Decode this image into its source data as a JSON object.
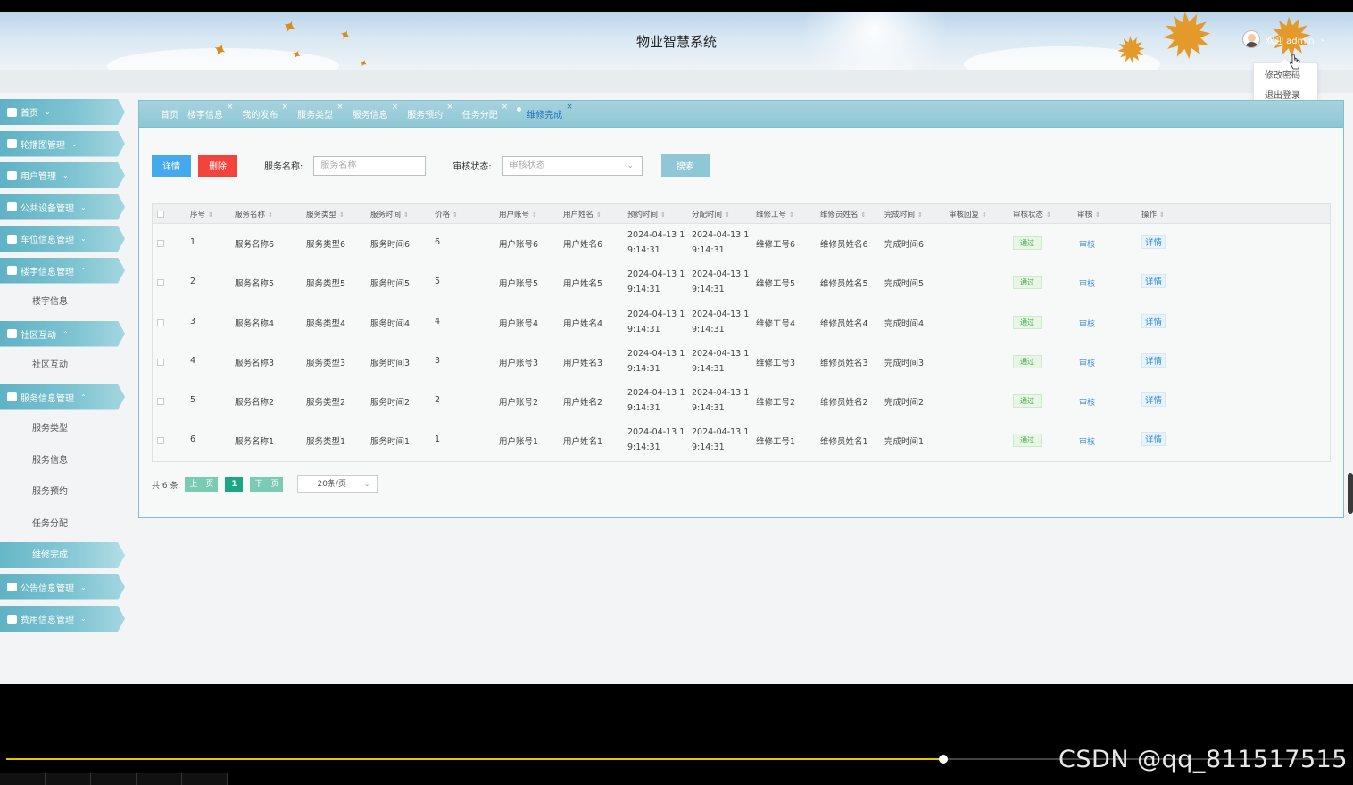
{
  "header": {
    "title": "物业智慧系统",
    "welcome": "欢迎 admin",
    "menu": [
      "修改密码",
      "退出登录"
    ]
  },
  "sidebar": {
    "items": [
      {
        "label": "首页",
        "icon": "home-icon",
        "type": "nav"
      },
      {
        "label": "轮播图管理",
        "icon": "image-icon",
        "type": "nav"
      },
      {
        "label": "用户管理",
        "icon": "user-icon",
        "type": "nav"
      },
      {
        "label": "公共设备管理",
        "icon": "grid-icon",
        "type": "nav"
      },
      {
        "label": "车位信息管理",
        "icon": "car-icon",
        "type": "nav"
      },
      {
        "label": "楼宇信息管理",
        "icon": "building-icon",
        "type": "nav-open"
      },
      {
        "label": "楼宇信息",
        "type": "sub"
      },
      {
        "label": "社区互动",
        "icon": "community-icon",
        "type": "nav-open"
      },
      {
        "label": "社区互动",
        "type": "sub"
      },
      {
        "label": "服务信息管理",
        "icon": "service-icon",
        "type": "nav-open"
      },
      {
        "label": "服务类型",
        "type": "sub"
      },
      {
        "label": "服务信息",
        "type": "sub"
      },
      {
        "label": "服务预约",
        "type": "sub"
      },
      {
        "label": "任务分配",
        "type": "sub"
      },
      {
        "label": "维修完成",
        "type": "sub-active"
      },
      {
        "label": "公告信息管理",
        "icon": "notice-icon",
        "type": "nav"
      },
      {
        "label": "费用信息管理",
        "icon": "fee-icon",
        "type": "nav"
      }
    ]
  },
  "tabs": [
    {
      "label": "首页",
      "closable": false
    },
    {
      "label": "楼宇信息",
      "closable": true
    },
    {
      "label": "我的发布",
      "closable": true
    },
    {
      "label": "服务类型",
      "closable": true
    },
    {
      "label": "服务信息",
      "closable": true
    },
    {
      "label": "服务预约",
      "closable": true
    },
    {
      "label": "任务分配",
      "closable": true
    },
    {
      "label": "维修完成",
      "closable": true,
      "active": true
    }
  ],
  "toolbar": {
    "detail_label": "详情",
    "delete_label": "删除",
    "name_label": "服务名称:",
    "name_placeholder": "服务名称",
    "status_label": "审核状态:",
    "status_placeholder": "审核状态",
    "search_label": "搜索"
  },
  "table": {
    "columns": [
      "序号",
      "服务名称",
      "服务类型",
      "服务时间",
      "价格",
      "用户账号",
      "用户姓名",
      "预约时间",
      "分配时间",
      "维修工号",
      "维修员姓名",
      "完成时间",
      "审核回复",
      "审核状态",
      "审核",
      "操作"
    ],
    "rows": [
      {
        "no": "1",
        "name": "服务名称6",
        "type": "服务类型6",
        "time": "服务时间6",
        "price": "6",
        "account": "用户账号6",
        "user": "用户姓名6",
        "book1": "2024-04-13 1",
        "book2": "9:14:31",
        "assign1": "2024-04-13 1",
        "assign2": "9:14:31",
        "worker_no": "维修工号6",
        "worker": "维修员姓名6",
        "done": "完成时间6",
        "reply": "",
        "status": "通过",
        "audit": "审核",
        "op": "详情"
      },
      {
        "no": "2",
        "name": "服务名称5",
        "type": "服务类型5",
        "time": "服务时间5",
        "price": "5",
        "account": "用户账号5",
        "user": "用户姓名5",
        "book1": "2024-04-13 1",
        "book2": "9:14:31",
        "assign1": "2024-04-13 1",
        "assign2": "9:14:31",
        "worker_no": "维修工号5",
        "worker": "维修员姓名5",
        "done": "完成时间5",
        "reply": "",
        "status": "通过",
        "audit": "审核",
        "op": "详情"
      },
      {
        "no": "3",
        "name": "服务名称4",
        "type": "服务类型4",
        "time": "服务时间4",
        "price": "4",
        "account": "用户账号4",
        "user": "用户姓名4",
        "book1": "2024-04-13 1",
        "book2": "9:14:31",
        "assign1": "2024-04-13 1",
        "assign2": "9:14:31",
        "worker_no": "维修工号4",
        "worker": "维修员姓名4",
        "done": "完成时间4",
        "reply": "",
        "status": "通过",
        "audit": "审核",
        "op": "详情"
      },
      {
        "no": "4",
        "name": "服务名称3",
        "type": "服务类型3",
        "time": "服务时间3",
        "price": "3",
        "account": "用户账号3",
        "user": "用户姓名3",
        "book1": "2024-04-13 1",
        "book2": "9:14:31",
        "assign1": "2024-04-13 1",
        "assign2": "9:14:31",
        "worker_no": "维修工号3",
        "worker": "维修员姓名3",
        "done": "完成时间3",
        "reply": "",
        "status": "通过",
        "audit": "审核",
        "op": "详情"
      },
      {
        "no": "5",
        "name": "服务名称2",
        "type": "服务类型2",
        "time": "服务时间2",
        "price": "2",
        "account": "用户账号2",
        "user": "用户姓名2",
        "book1": "2024-04-13 1",
        "book2": "9:14:31",
        "assign1": "2024-04-13 1",
        "assign2": "9:14:31",
        "worker_no": "维修工号2",
        "worker": "维修员姓名2",
        "done": "完成时间2",
        "reply": "",
        "status": "通过",
        "audit": "审核",
        "op": "详情"
      },
      {
        "no": "6",
        "name": "服务名称1",
        "type": "服务类型1",
        "time": "服务时间1",
        "price": "1",
        "account": "用户账号1",
        "user": "用户姓名1",
        "book1": "2024-04-13 1",
        "book2": "9:14:31",
        "assign1": "2024-04-13 1",
        "assign2": "9:14:31",
        "worker_no": "维修工号1",
        "worker": "维修员姓名1",
        "done": "完成时间1",
        "reply": "",
        "status": "通过",
        "audit": "审核",
        "op": "详情"
      }
    ]
  },
  "pager": {
    "total": "共 6 条",
    "prev": "上一页",
    "current": "1",
    "next": "下一页",
    "size": "20条/页"
  },
  "video": {
    "progress": 0.7,
    "watermark": "CSDN @qq_811517515"
  },
  "colors": {
    "accent": "#7fc4d2",
    "pager_active": "#1ba784",
    "status_ok": "#3aa341"
  }
}
